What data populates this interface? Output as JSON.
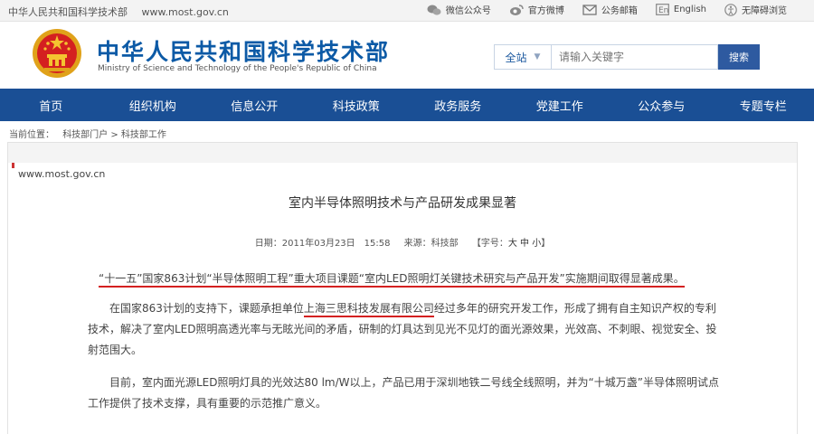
{
  "topbar": {
    "site_name": "中华人民共和国科学技术部",
    "url": "www.most.gov.cn",
    "links": [
      "微信公众号",
      "官方微博",
      "公务邮箱",
      "English",
      "无障碍浏览"
    ]
  },
  "header": {
    "title_cn": "中华人民共和国科学技术部",
    "title_en": "Ministry of Science and Technology of the People's Republic of China"
  },
  "search": {
    "scope": "全站",
    "placeholder": "请输入关键字",
    "button": "搜索"
  },
  "nav": [
    "首页",
    "组织机构",
    "信息公开",
    "科技政策",
    "政务服务",
    "党建工作",
    "公众参与",
    "专题专栏"
  ],
  "breadcrumb": {
    "label": "当前位置：",
    "path": "科技部门户 > 科技部工作"
  },
  "article": {
    "source_url": "www.most.gov.cn",
    "title": "室内半导体照明技术与产品研发成果显著",
    "date": "日期：2011年03月23日　15:58",
    "source": "来源：科技部",
    "font_size_prefix": "【字号：",
    "font_size_options": "大 中 小",
    "font_size_suffix": "】",
    "lead": "“十一五”国家863计划“半导体照明工程”重大项目课题“室内LED照明灯关键技术研究与产品开发”实施期间取得显著成果。",
    "para2_a": "在国家863计划的支持下，课题承担单位",
    "para2_company": "上海三思科技发展有限公司",
    "para2_b": "经过多年的研究开发工作，形成了拥有自主知识产权的专利技术，解决了室内LED照明高透光率与无眩光间的矛盾，研制的灯具达到见光不见灯的面光源效果，光效高、不刺眼、视觉安全、投射范围大。",
    "para3": "目前，室内面光源LED照明灯具的光效达80 lm/W以上，产品已用于深圳地铁二号线全线照明，并为“十城万盏”半导体照明试点工作提供了技术支撑，具有重要的示范推广意义。"
  },
  "colors": {
    "brand_blue": "#1a4f95",
    "title_blue": "#0c5aa6",
    "highlight_red": "#d42020"
  }
}
